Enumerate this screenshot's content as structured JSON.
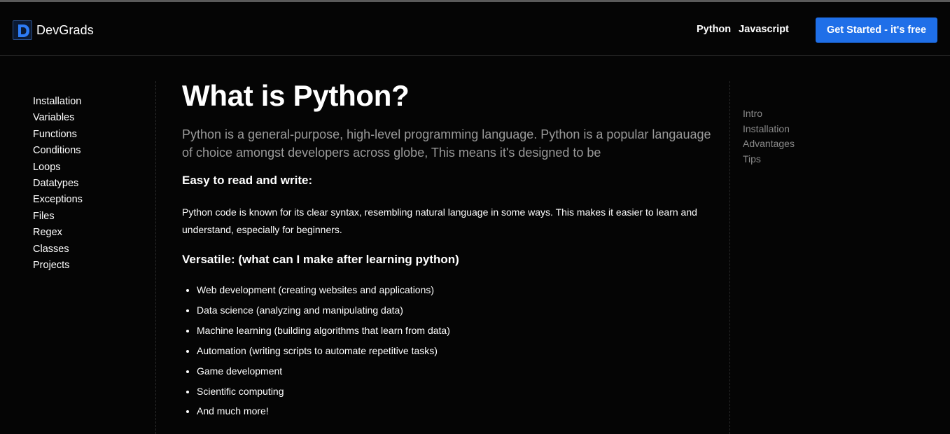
{
  "brand": {
    "name": "DevGrads",
    "logo_icon": "devgrads-logo-icon",
    "accent": "#1f6fe8"
  },
  "topnav": {
    "items": [
      "Python",
      "Javascript"
    ],
    "cta_label": "Get Started - it's free"
  },
  "sidebar": {
    "items": [
      "Installation",
      "Variables",
      "Functions",
      "Conditions",
      "Loops",
      "Datatypes",
      "Exceptions",
      "Files",
      "Regex",
      "Classes",
      "Projects"
    ]
  },
  "main": {
    "title": "What is Python?",
    "lead": "Python is a general-purpose, high-level programming language. Python is a popular langauage of choice amongst developers across globe, This means it's designed to be",
    "section1": {
      "heading": "Easy to read and write:",
      "paragraph": "Python code is known for its clear syntax, resembling natural language in some ways. This makes it easier to learn and understand, especially for beginners."
    },
    "section2": {
      "heading": "Versatile: (what can I make after learning python)",
      "items": [
        "Web development (creating websites and applications)",
        "Data science (analyzing and manipulating data)",
        "Machine learning (building algorithms that learn from data)",
        "Automation (writing scripts to automate repetitive tasks)",
        "Game development",
        "Scientific computing",
        "And much more!"
      ]
    }
  },
  "toc": {
    "items": [
      "Intro",
      "Installation",
      "Advantages",
      "Tips"
    ]
  }
}
